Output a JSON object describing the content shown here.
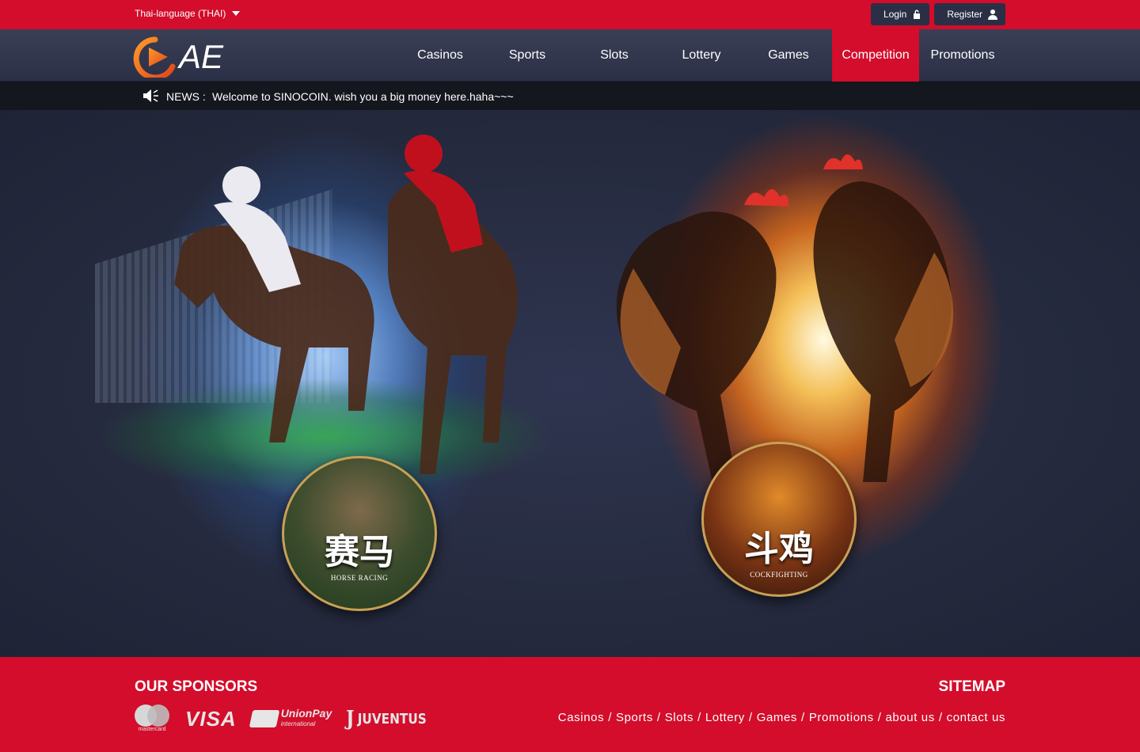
{
  "topbar": {
    "language": "Thai-language (THAI)",
    "login_label": "Login",
    "register_label": "Register"
  },
  "nav": {
    "logo_text": "AE",
    "items": [
      {
        "label": "Casinos"
      },
      {
        "label": "Sports"
      },
      {
        "label": "Slots"
      },
      {
        "label": "Lottery"
      },
      {
        "label": "Games"
      },
      {
        "label": "Competition",
        "active": true
      },
      {
        "label": "Promotions"
      }
    ]
  },
  "news": {
    "label": "NEWS :",
    "text": "Welcome to SINOCOIN. wish you a big money here.haha~~~"
  },
  "hero": {
    "horse": {
      "title": "赛马",
      "subtitle": "HORSE RACING"
    },
    "cock": {
      "title": "斗鸡",
      "subtitle": "COCKFIGHTING"
    }
  },
  "footer": {
    "sponsors_title": "OUR SPONSORS",
    "sitemap_title": "SITEMAP",
    "sponsors": {
      "mastercard": "mastercard",
      "visa": "VISA",
      "unionpay": "UnionPay",
      "unionpay_sub": "international",
      "juventus": "JUVENTUS"
    },
    "links": [
      "Casinos",
      "Sports",
      "Slots",
      "Lottery",
      "Games",
      "Promotions",
      "about us",
      "contact us"
    ],
    "separator": "/"
  },
  "colors": {
    "brand_red": "#d30d2b",
    "nav_bg": "#2b3046",
    "hero_bg": "#252a3e",
    "logo_orange": "#f07a1a"
  }
}
